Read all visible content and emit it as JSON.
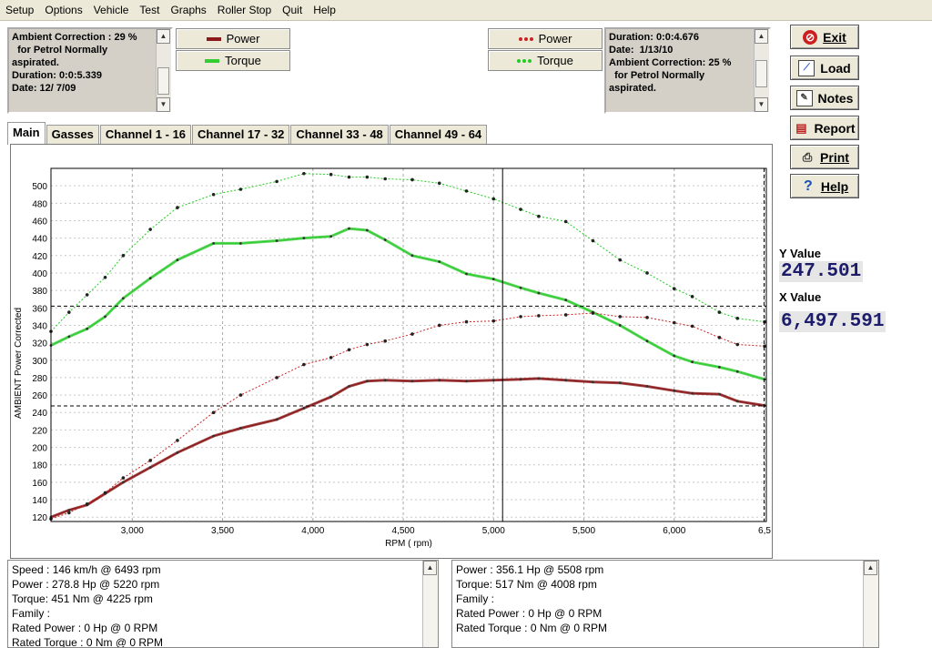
{
  "menu": [
    "Setup",
    "Options",
    "Vehicle",
    "Test",
    "Graphs",
    "Roller Stop",
    "Quit",
    "Help"
  ],
  "left_info": [
    "Ambient Correction : 29 %",
    "  for Petrol Normally",
    "aspirated.",
    "Duration: 0:0:5.339",
    "Date: 12/ 7/09"
  ],
  "right_info": [
    "Duration: 0:0:4.676",
    "Date:  1/13/10",
    "Ambient Correction: 25 %",
    "  for Petrol Normally",
    "aspirated."
  ],
  "legend_left": [
    {
      "label": "Power",
      "color": "#8b1a1a"
    },
    {
      "label": "Torque",
      "color": "#33cc33"
    }
  ],
  "legend_right": [
    {
      "label": "Power",
      "color": "#cc2222"
    },
    {
      "label": "Torque",
      "color": "#22cc22"
    }
  ],
  "buttons": {
    "exit": "Exit",
    "load": "Load",
    "notes": "Notes",
    "report": "Report",
    "print": "Print",
    "help": "Help"
  },
  "tabs": [
    "Main",
    "Gasses",
    "Channel 1 - 16",
    "Channel 17 - 32",
    "Channel 33 - 48",
    "Channel 49 - 64"
  ],
  "readout": {
    "y_label": "Y Value",
    "y_value": "247.501",
    "x_label": "X Value",
    "x_value": "6,497.591"
  },
  "stats_left": [
    "Speed : 146 km/h @ 6493 rpm",
    "Power : 278.8 Hp @ 5220 rpm",
    "Torque: 451 Nm @ 4225 rpm",
    "Family :",
    "Rated Power : 0 Hp @ 0 RPM",
    "Rated Torque : 0 Nm @ 0 RPM"
  ],
  "stats_right": [
    "Power : 356.1 Hp @ 5508 rpm",
    "Torque: 517 Nm @ 4008 rpm",
    "Family :",
    "Rated Power : 0 Hp @ 0 RPM",
    "Rated Torque : 0 Nm @ 0 RPM"
  ],
  "chart_data": {
    "type": "line",
    "xlabel": "RPM ( rpm)",
    "ylabel": "AMBIENT Power Corrected",
    "xlim": [
      2550,
      6510
    ],
    "ylim": [
      115,
      520
    ],
    "xticks": [
      3000,
      3500,
      4000,
      4500,
      5000,
      5500,
      6000,
      6500
    ],
    "xtick_labels": [
      "3,000",
      "3,500",
      "4,000",
      "4,500",
      "5,000",
      "5,500",
      "6,000",
      "6,5"
    ],
    "yticks": [
      120,
      140,
      160,
      180,
      200,
      220,
      240,
      260,
      280,
      300,
      320,
      340,
      360,
      380,
      400,
      420,
      440,
      460,
      480,
      500
    ],
    "crosshair": {
      "x": 6497.591,
      "y": 247.501,
      "x2": 5050,
      "y2": 362
    },
    "grid": true,
    "series": [
      {
        "name": "Torque",
        "color": "#33cc33",
        "style": "solid",
        "x": [
          2550,
          2650,
          2750,
          2850,
          2950,
          3100,
          3250,
          3450,
          3600,
          3800,
          3950,
          4100,
          4200,
          4300,
          4400,
          4550,
          4700,
          4850,
          5000,
          5150,
          5250,
          5400,
          5550,
          5700,
          5850,
          6000,
          6100,
          6250,
          6350,
          6500
        ],
        "y": [
          317,
          327,
          336,
          350,
          371,
          394,
          415,
          434,
          434,
          437,
          440,
          442,
          451,
          449,
          438,
          420,
          413,
          399,
          393,
          383,
          377,
          369,
          355,
          340,
          322,
          305,
          298,
          292,
          287,
          278
        ]
      },
      {
        "name": "Power",
        "color": "#8b1a1a",
        "style": "solid",
        "x": [
          2550,
          2650,
          2750,
          2850,
          2950,
          3100,
          3250,
          3450,
          3600,
          3800,
          3950,
          4100,
          4200,
          4300,
          4400,
          4550,
          4700,
          4850,
          5000,
          5150,
          5250,
          5400,
          5550,
          5700,
          5850,
          6000,
          6100,
          6250,
          6350,
          6500
        ],
        "y": [
          120,
          128,
          134,
          147,
          160,
          177,
          194,
          213,
          222,
          232,
          245,
          258,
          270,
          276,
          277,
          276,
          277,
          276,
          277,
          278,
          279,
          277,
          275,
          274,
          270,
          265,
          262,
          261,
          253,
          248
        ]
      },
      {
        "name": "Torque",
        "color": "#22cc22",
        "style": "dotted",
        "x": [
          2550,
          2650,
          2750,
          2850,
          2950,
          3100,
          3250,
          3450,
          3600,
          3800,
          3950,
          4100,
          4200,
          4300,
          4400,
          4550,
          4700,
          4850,
          5000,
          5150,
          5250,
          5400,
          5550,
          5700,
          5850,
          6000,
          6100,
          6250,
          6350,
          6500
        ],
        "y": [
          333,
          355,
          375,
          395,
          420,
          450,
          475,
          490,
          496,
          505,
          514,
          513,
          510,
          510,
          508,
          507,
          503,
          494,
          485,
          473,
          465,
          459,
          437,
          415,
          400,
          382,
          373,
          355,
          348,
          344
        ]
      },
      {
        "name": "Power",
        "color": "#cc2222",
        "style": "dotted",
        "x": [
          2550,
          2650,
          2750,
          2850,
          2950,
          3100,
          3250,
          3450,
          3600,
          3800,
          3950,
          4100,
          4200,
          4300,
          4400,
          4550,
          4700,
          4850,
          5000,
          5150,
          5250,
          5400,
          5550,
          5700,
          5850,
          6000,
          6100,
          6250,
          6350,
          6500
        ],
        "y": [
          118,
          125,
          135,
          148,
          165,
          185,
          208,
          240,
          260,
          280,
          295,
          303,
          312,
          318,
          322,
          330,
          340,
          344,
          345,
          350,
          351,
          352,
          354,
          350,
          349,
          343,
          339,
          326,
          318,
          316
        ]
      }
    ]
  }
}
